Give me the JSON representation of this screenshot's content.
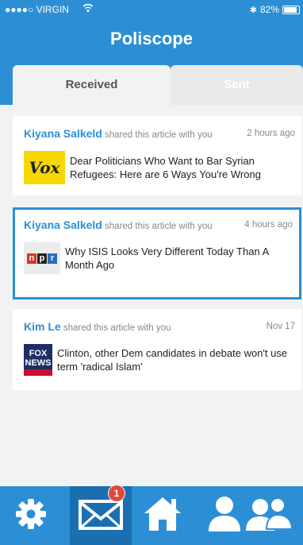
{
  "status_bar": {
    "carrier": "●●●●○ VIRGIN",
    "wifi_icon": "wifi-icon",
    "bluetooth_icon": "bluetooth-icon",
    "battery_percent": "82%",
    "battery_level": 0.82
  },
  "header": {
    "title": "Poliscope"
  },
  "tabs": [
    {
      "label": "Received",
      "active": true
    },
    {
      "label": "Sent",
      "active": false
    }
  ],
  "articles": [
    {
      "sender": "Kiyana Salkeld",
      "shared_text": " shared this article with you",
      "time": "2 hours ago",
      "source_logo": "Vox",
      "headline": "Dear Politicians Who Want to Bar Syrian Refugees: Here are 6 Ways You're Wrong",
      "selected": false
    },
    {
      "sender": "Kiyana Salkeld",
      "shared_text": " shared this article with you",
      "time": "4 hours ago",
      "source_logo": [
        "n",
        "p",
        "r"
      ],
      "headline": "Why ISIS Looks Very Different Today Than A Month Ago",
      "selected": true
    },
    {
      "sender": "Kim Le",
      "shared_text": " shared this article with you",
      "time": "Nov 17",
      "source_logo": [
        "FOX",
        "NEWS"
      ],
      "headline": "Clinton, other Dem candidates in debate won't use term 'radical Islam'",
      "selected": false
    }
  ],
  "tab_bar": {
    "items": [
      {
        "icon": "gear-icon",
        "active": false
      },
      {
        "icon": "envelope-icon",
        "active": true,
        "badge": "1"
      },
      {
        "icon": "home-icon",
        "active": false
      },
      {
        "icon": "person-icon",
        "active": false
      },
      {
        "icon": "people-icon",
        "active": false
      }
    ]
  },
  "colors": {
    "brand_blue": "#2c8fd6",
    "active_tab_blue": "#1a6fb1",
    "badge_red": "#e2483c",
    "vox_yellow": "#f6d800",
    "npr_red": "#d6362b",
    "npr_black": "#222222",
    "npr_blue": "#2a6ebb",
    "fox_navy": "#1d2f66"
  }
}
